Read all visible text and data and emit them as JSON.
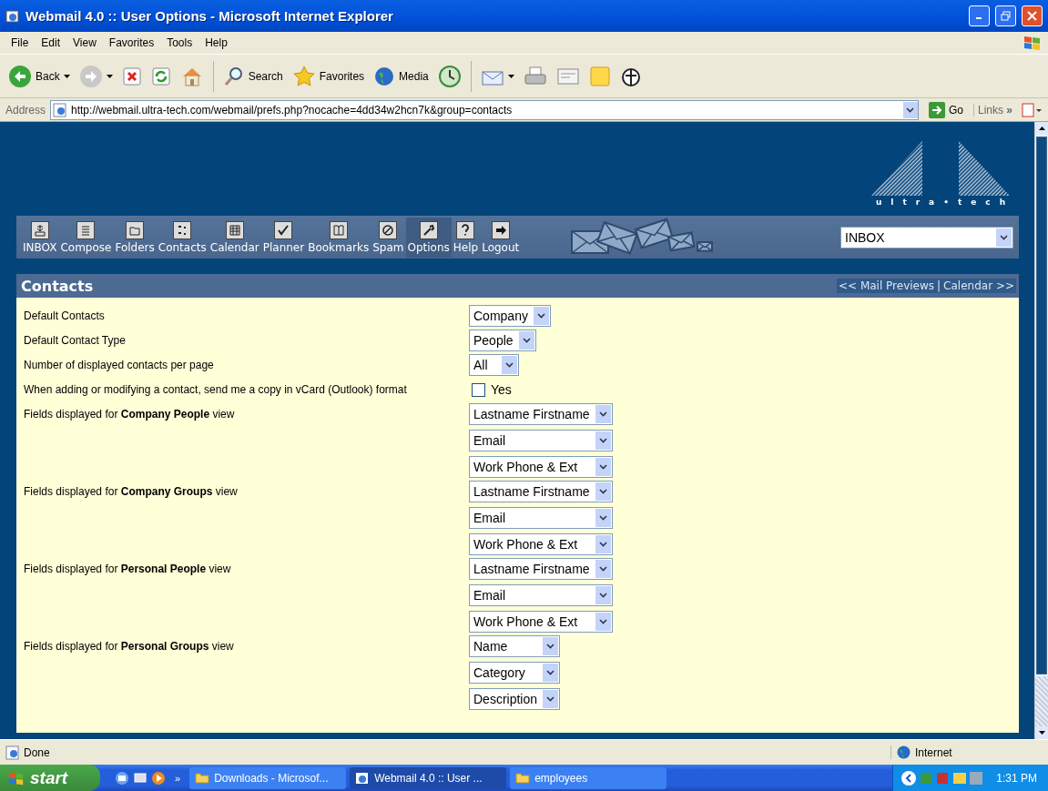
{
  "window": {
    "title": "Webmail 4.0 :: User Options - Microsoft Internet Explorer"
  },
  "menu": [
    "File",
    "Edit",
    "View",
    "Favorites",
    "Tools",
    "Help"
  ],
  "toolbar": [
    "Back",
    "Search",
    "Favorites",
    "Media"
  ],
  "address": {
    "label": "Address",
    "url": "http://webmail.ultra-tech.com/webmail/prefs.php?nocache=4dd34w2hcn7k&group=contacts",
    "go": "Go",
    "links": "Links",
    "links_more": "»"
  },
  "webmail": {
    "logo_text": "ultra•tech",
    "nav": [
      {
        "label": "INBOX",
        "selected": false
      },
      {
        "label": "Compose",
        "selected": false
      },
      {
        "label": "Folders",
        "selected": false
      },
      {
        "label": "Contacts",
        "selected": false
      },
      {
        "label": "Calendar",
        "selected": false
      },
      {
        "label": "Planner",
        "selected": false
      },
      {
        "label": "Bookmarks",
        "selected": false
      },
      {
        "label": "Spam",
        "selected": false
      },
      {
        "label": "Options",
        "selected": true
      },
      {
        "label": "Help",
        "selected": false
      },
      {
        "label": "Logout",
        "selected": false
      }
    ],
    "folder_select": "INBOX",
    "section": {
      "title": "Contacts",
      "links": [
        "<< Mail Previews",
        "Calendar >>"
      ],
      "separator": "|"
    },
    "options": [
      {
        "kind": "select",
        "label": "Default Contacts",
        "values": [
          "Company"
        ]
      },
      {
        "kind": "select",
        "label": "Default Contact Type",
        "values": [
          "People"
        ]
      },
      {
        "kind": "select",
        "label": "Number of displayed contacts per page",
        "values": [
          "All"
        ]
      },
      {
        "kind": "checkbox",
        "label": "When adding or modifying a contact, send me a copy in vCard (Outlook) format",
        "checked": false,
        "text": "Yes"
      },
      {
        "kind": "select",
        "label": "Fields displayed for **Company People** view",
        "values": [
          "Lastname Firstname",
          "Email",
          "Work Phone & Ext"
        ]
      },
      {
        "kind": "select",
        "label": "Fields displayed for **Company Groups** view",
        "values": [
          "Lastname Firstname",
          "Email",
          "Work Phone & Ext"
        ]
      },
      {
        "kind": "select",
        "label": "Fields displayed for **Personal People** view",
        "values": [
          "Lastname Firstname",
          "Email",
          "Work Phone & Ext"
        ]
      },
      {
        "kind": "select",
        "label": "Fields displayed for **Personal Groups** view",
        "values": [
          "Name",
          "Category",
          "Description"
        ]
      }
    ]
  },
  "status_bar": {
    "text": "Done",
    "zone": "Internet"
  },
  "taskbar": {
    "start": "start",
    "more": "»",
    "tasks": [
      {
        "label": "Downloads - Microsof...",
        "selected": false
      },
      {
        "label": "Webmail 4.0 :: User ...",
        "selected": true
      },
      {
        "label": "employees",
        "selected": false
      }
    ],
    "clock": "1:31 PM"
  }
}
